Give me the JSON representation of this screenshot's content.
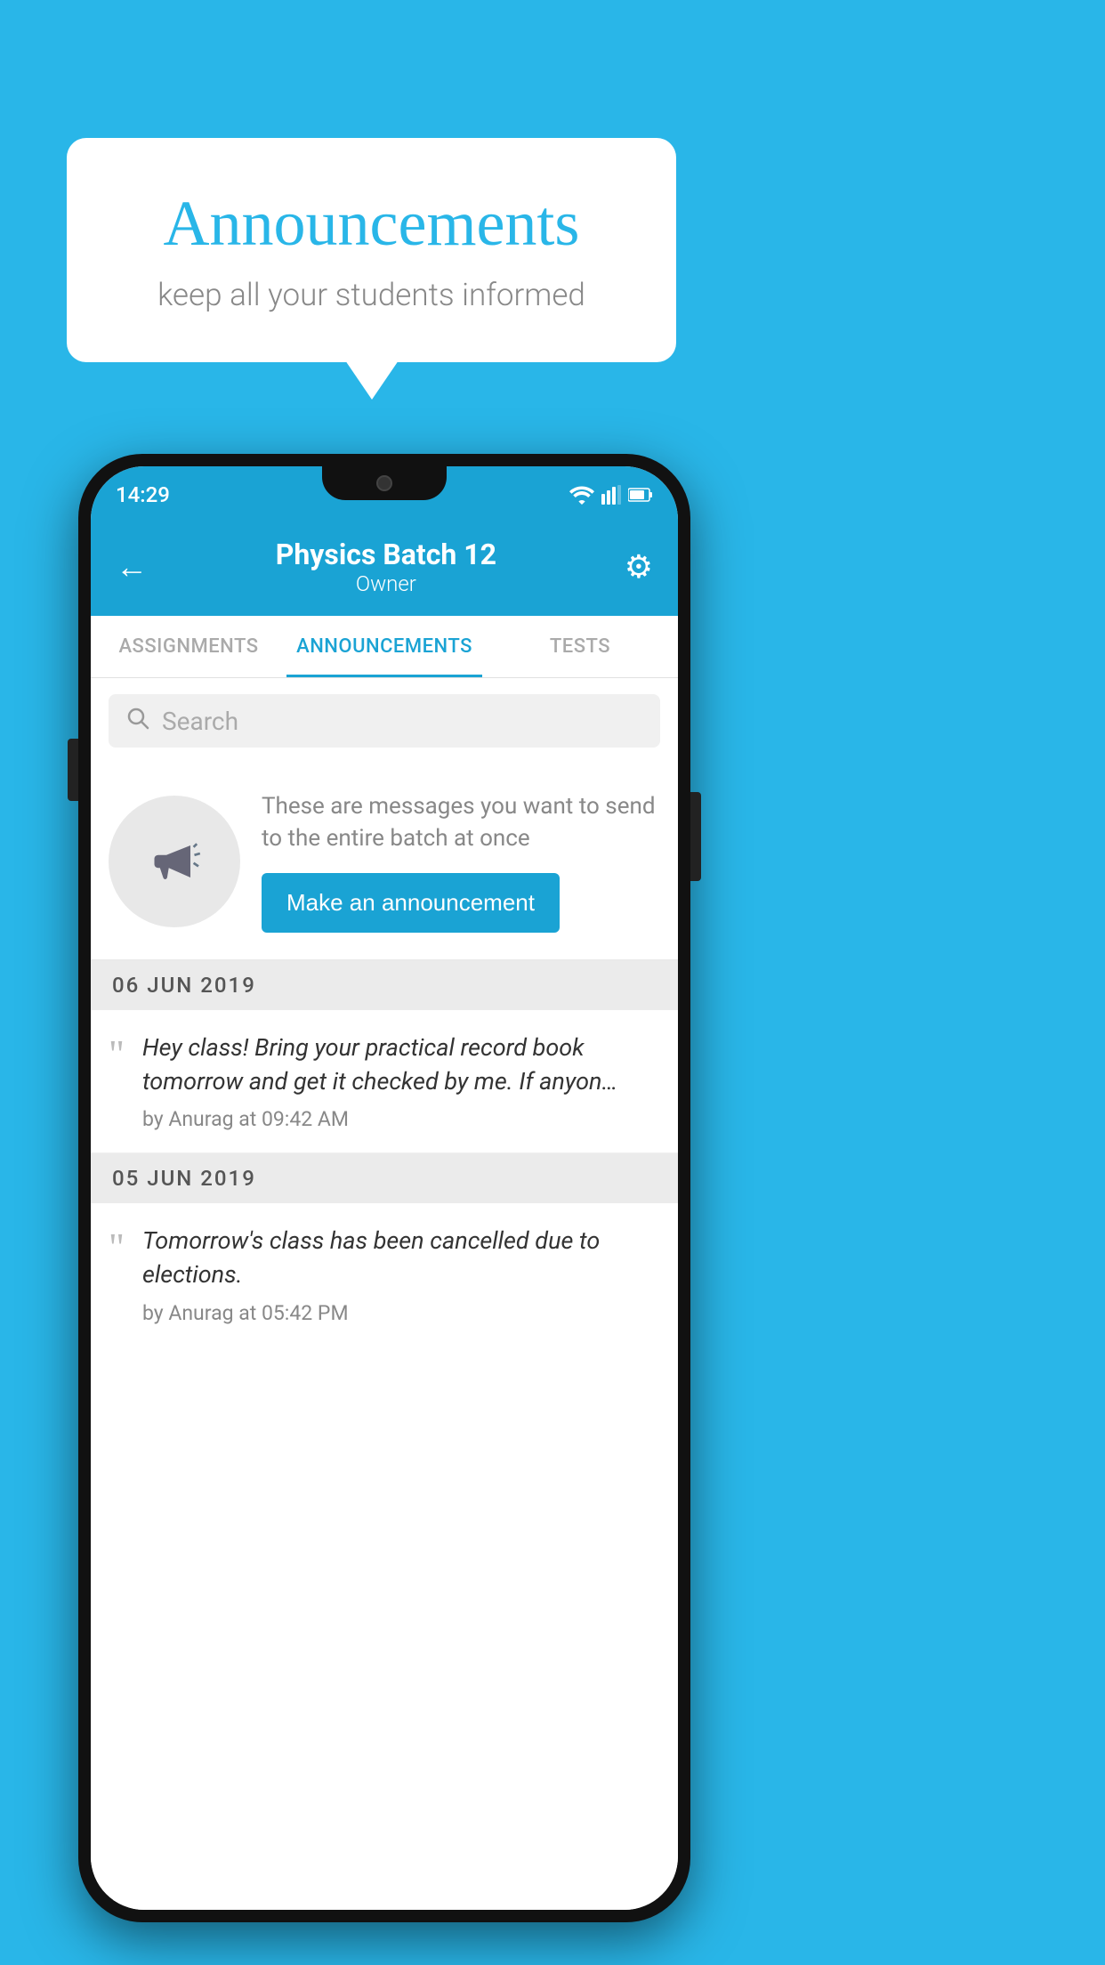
{
  "background_color": "#29b6e8",
  "speech_bubble": {
    "title": "Announcements",
    "subtitle": "keep all your students informed"
  },
  "phone": {
    "status_bar": {
      "time": "14:29"
    },
    "header": {
      "back_label": "←",
      "title": "Physics Batch 12",
      "subtitle": "Owner",
      "gear_icon": "⚙"
    },
    "tabs": [
      {
        "label": "ASSIGNMENTS",
        "active": false
      },
      {
        "label": "ANNOUNCEMENTS",
        "active": true
      },
      {
        "label": "TESTS",
        "active": false
      }
    ],
    "search": {
      "placeholder": "Search"
    },
    "empty_state": {
      "description": "These are messages you want to send to the entire batch at once",
      "button_label": "Make an announcement"
    },
    "announcements": [
      {
        "date": "06  JUN  2019",
        "message": "Hey class! Bring your practical record book tomorrow and get it checked by me. If anyon…",
        "meta": "by Anurag at 09:42 AM"
      },
      {
        "date": "05  JUN  2019",
        "message": "Tomorrow's class has been cancelled due to elections.",
        "meta": "by Anurag at 05:42 PM"
      }
    ]
  }
}
